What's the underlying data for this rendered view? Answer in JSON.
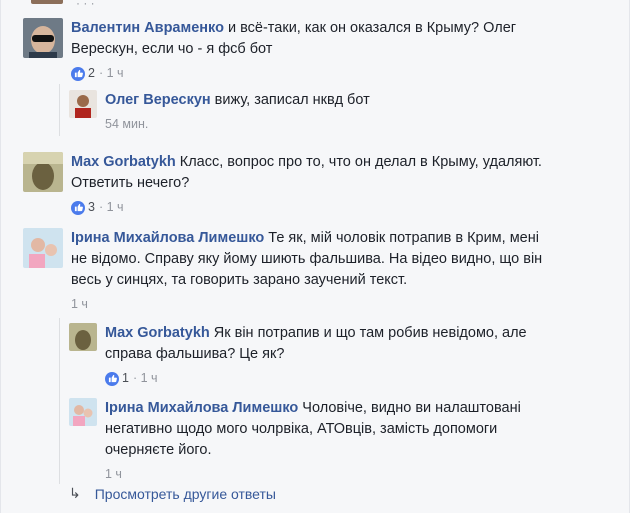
{
  "comments": [
    {
      "author": "Валентин Авраменко",
      "text": " и всё-таки, как он оказался в Крыму? Олег",
      "text2": "Верескун, если чо - я фсб бот",
      "likes": "2",
      "time": " · 1 ч"
    },
    {
      "author": "Олег Верескун",
      "text": " вижу, записал нквд бот",
      "time": "54 мин."
    },
    {
      "author": "Max Gorbatykh",
      "text": " Класс, вопрос про то, что он делал в Крыму, удаляют.",
      "text2": "Ответить нечего?",
      "likes": "3",
      "time": " · 1 ч"
    },
    {
      "author": "Ірина Михайлова Лимешко",
      "text": " Те як, мій чоловік потрапив в Крим, мені",
      "text2": "не відомо. Справу яку йому шиють фальшива. На відео видно, що він",
      "text3": "весь у синцях, та говорить зарано заучений текст.",
      "time": "1 ч"
    },
    {
      "author": "Max Gorbatykh",
      "text": " Як він потрапив и що там робив невідомо, але",
      "text2": "справа фальшива? Це як?",
      "likes": "1",
      "time": " · 1 ч"
    },
    {
      "author": "Ірина Михайлова Лимешко",
      "text": " Чоловіче, видно ви налаштовані",
      "text2": "негативно щодо мого чолрвіка, АТОвців, замість допомоги",
      "text3": "очерняєте його.",
      "time": "1 ч"
    }
  ],
  "more_replies": "Просмотреть другие ответы",
  "colors": {
    "name": "#365899",
    "meta": "#90949c",
    "like": "#4b7bec"
  }
}
